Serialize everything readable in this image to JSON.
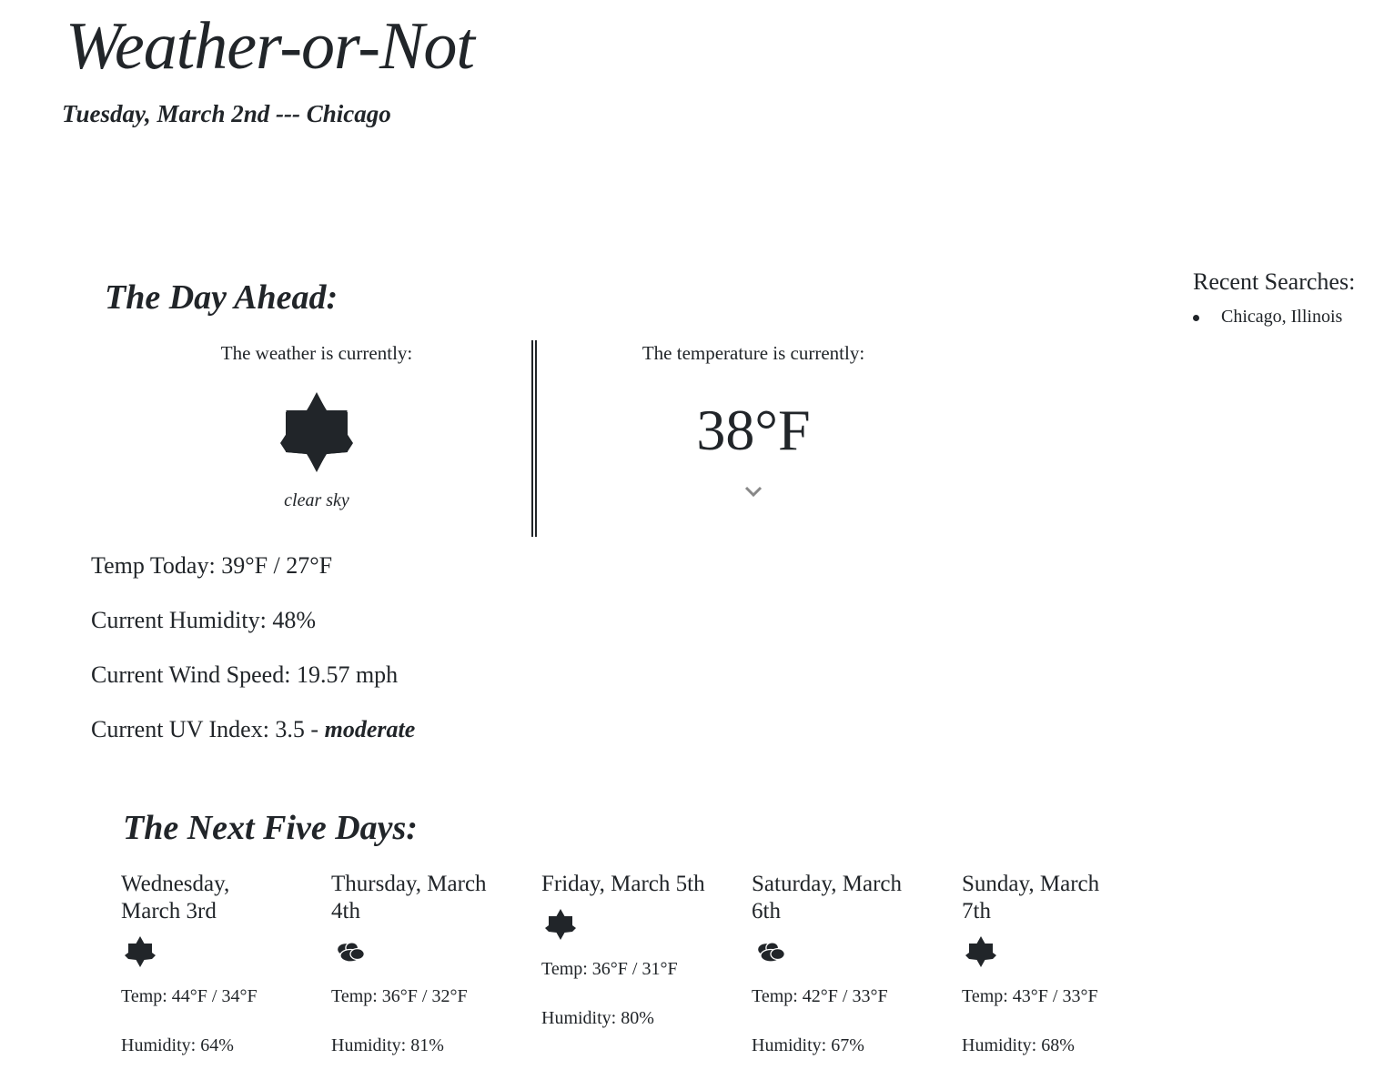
{
  "header": {
    "title": "Weather-or-Not",
    "date_city": "Tuesday, March 2nd --- Chicago"
  },
  "recent": {
    "heading": "Recent Searches:",
    "items": [
      "Chicago, Illinois"
    ]
  },
  "day_ahead": {
    "title": "The Day Ahead:",
    "weather_label": "The weather is currently:",
    "weather_icon": "sun-icon",
    "weather_desc": "clear sky",
    "temp_label": "The temperature is currently:",
    "temp_now": "38°F",
    "expand_icon": "chevron-down-icon",
    "temp_today": "Temp Today: 39°F / 27°F",
    "humidity": "Current Humidity: 48%",
    "wind": "Current Wind Speed: 19.57 mph",
    "uv_prefix": "Current UV Index: 3.5 - ",
    "uv_level": "moderate"
  },
  "five_day": {
    "title": "The Next Five Days:",
    "days": [
      {
        "name": "Wednesday, March 3rd",
        "icon": "sun-icon",
        "temp": "Temp: 44°F / 34°F",
        "humidity": "Humidity: 64%"
      },
      {
        "name": "Thursday, March 4th",
        "icon": "clouds-icon",
        "temp": "Temp: 36°F / 32°F",
        "humidity": "Humidity: 81%"
      },
      {
        "name": "Friday, March 5th",
        "icon": "sun-icon",
        "temp": "Temp: 36°F / 31°F",
        "humidity": "Humidity: 80%"
      },
      {
        "name": "Saturday, March 6th",
        "icon": "clouds-icon",
        "temp": "Temp: 42°F / 33°F",
        "humidity": "Humidity: 67%"
      },
      {
        "name": "Sunday, March 7th",
        "icon": "sun-icon",
        "temp": "Temp: 43°F / 33°F",
        "humidity": "Humidity: 68%"
      }
    ]
  },
  "colors": {
    "text": "#212529",
    "chevron": "#888888"
  }
}
